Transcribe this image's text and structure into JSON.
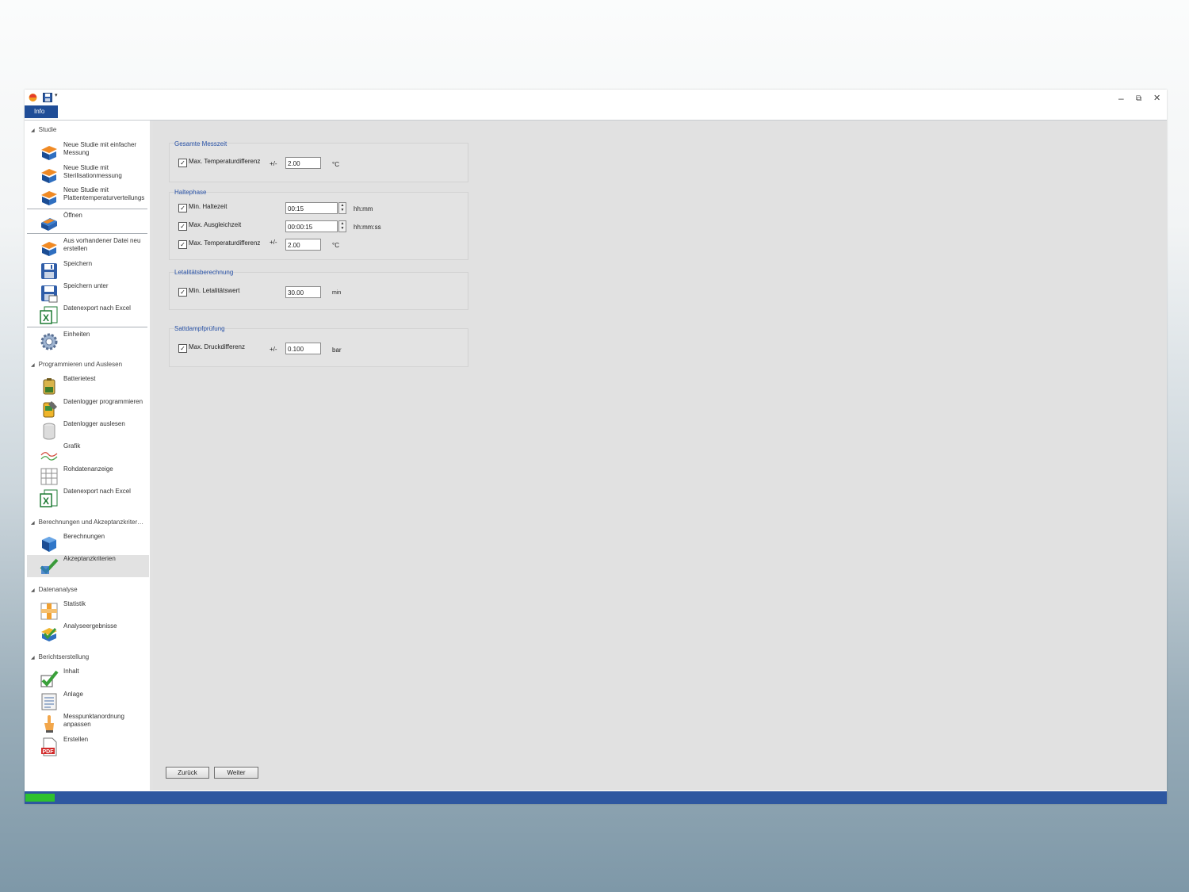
{
  "titlebar": {
    "info_tab": "Info",
    "window_buttons": {
      "minimize": "–",
      "restore": "⧉",
      "close": "✕"
    }
  },
  "sidebar": {
    "sections": [
      {
        "title": "Studie"
      },
      {
        "title": "Programmieren und Auslesen"
      },
      {
        "title": "Berechnungen und Akzeptanzkriter…"
      },
      {
        "title": "Datenanalyse"
      },
      {
        "title": "Berichtserstellung"
      }
    ],
    "items": [
      {
        "label": "Neue Studie mit einfacher Messung",
        "icon": "new-study-icon"
      },
      {
        "label": "Neue Studie mit Sterilisationmessung",
        "icon": "new-study-icon"
      },
      {
        "label": "Neue Studie mit Plattentemperaturverteilungs",
        "icon": "new-study-icon"
      },
      {
        "label": "Öffnen",
        "icon": "open-book-icon"
      },
      {
        "label": "Aus vorhandener Datei neu erstellen",
        "icon": "new-study-icon"
      },
      {
        "label": "Speichern",
        "icon": "save-icon"
      },
      {
        "label": "Speichern unter",
        "icon": "save-as-icon"
      },
      {
        "label": "Datenexport nach Excel",
        "icon": "excel-icon"
      },
      {
        "label": "Einheiten",
        "icon": "gear-icon"
      },
      {
        "label": "Batterietest",
        "icon": "battery-icon"
      },
      {
        "label": "Datenlogger programmieren",
        "icon": "logger-program-icon"
      },
      {
        "label": "Datenlogger auslesen",
        "icon": "logger-read-icon"
      },
      {
        "label": "Grafik",
        "icon": "graph-icon"
      },
      {
        "label": "Rohdatenanzeige",
        "icon": "grid-icon"
      },
      {
        "label": "Datenexport nach Excel",
        "icon": "excel-icon"
      },
      {
        "label": "Berechnungen",
        "icon": "calculator-icon"
      },
      {
        "label": "Akzeptanzkriterien",
        "icon": "checkmark-icon"
      },
      {
        "label": "Statistik",
        "icon": "statistics-icon"
      },
      {
        "label": "Analyseergebnisse",
        "icon": "analysis-icon"
      },
      {
        "label": "Inhalt",
        "icon": "checkmark-icon"
      },
      {
        "label": "Anlage",
        "icon": "document-icon"
      },
      {
        "label": "Messpunktanordnung anpassen",
        "icon": "pointer-icon"
      },
      {
        "label": "Erstellen",
        "icon": "pdf-icon"
      }
    ]
  },
  "groups": {
    "gesamte_messzeit": {
      "title": "Gesamte Messzeit",
      "rows": [
        {
          "label": "Max. Temperaturdifferenz",
          "checked": true,
          "prefix": "+/-",
          "value": "2.00",
          "unit": "°C"
        }
      ]
    },
    "haltephase": {
      "title": "Haltephase",
      "rows": [
        {
          "label": "Min. Haltezeit",
          "checked": true,
          "prefix": "",
          "value": "00:15",
          "unit": "hh:mm"
        },
        {
          "label": "Max. Ausgleichzeit",
          "checked": true,
          "prefix": "",
          "value": "00:00:15",
          "unit": "hh:mm:ss"
        },
        {
          "label": "Max. Temperaturdifferenz",
          "checked": true,
          "prefix": "+/-",
          "value": "2.00",
          "unit": "°C"
        }
      ]
    },
    "letalitaet": {
      "title": "Letalitätsberechnung",
      "rows": [
        {
          "label": "Min. Letalitätswert",
          "checked": true,
          "prefix": "",
          "value": "30.00",
          "unit": "min"
        }
      ]
    },
    "sattdampf": {
      "title": "Sattdampfprüfung",
      "rows": [
        {
          "label": "Max. Druckdifferenz",
          "checked": true,
          "prefix": "+/-",
          "value": "0.100",
          "unit": "bar"
        }
      ]
    }
  },
  "buttons": {
    "back": "Zurück",
    "next": "Weiter"
  },
  "status": {
    "progress": 0.03,
    "accent": "#2e57a0",
    "progress_color": "#2ec12e"
  }
}
